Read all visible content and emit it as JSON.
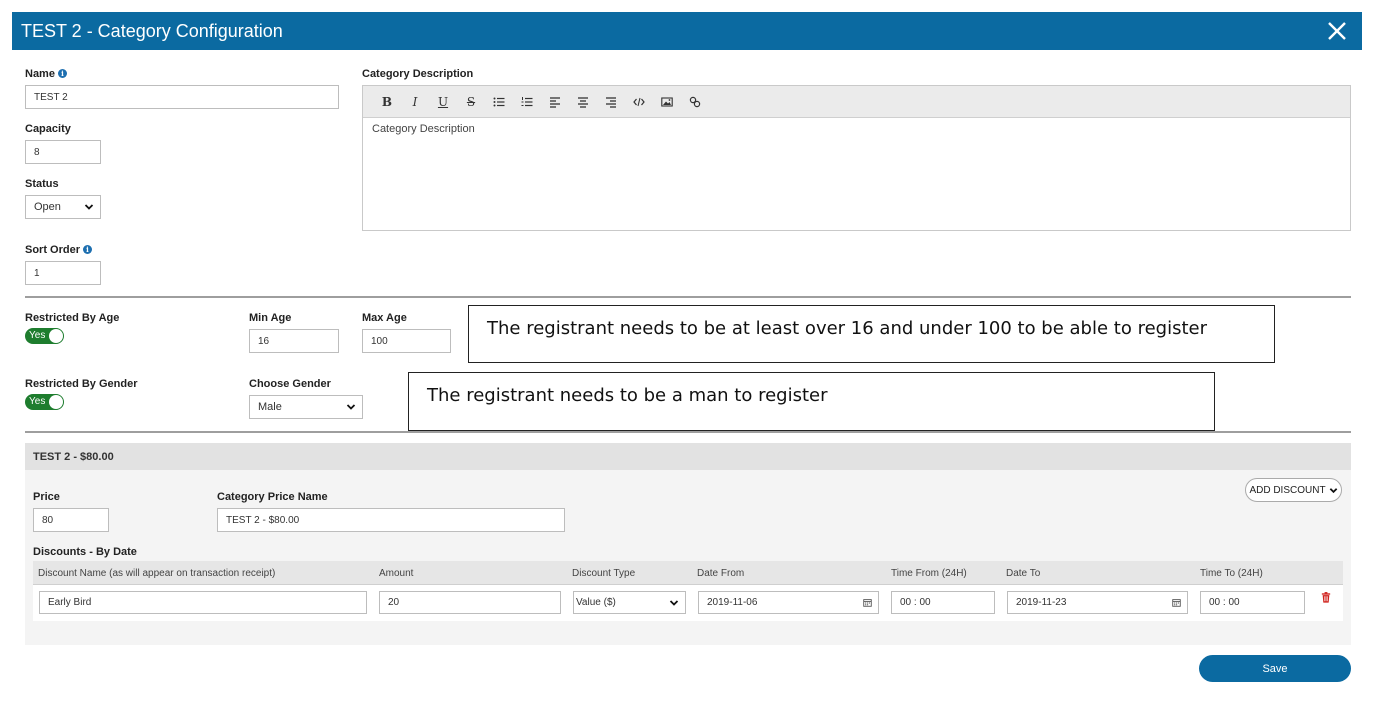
{
  "header": {
    "title": "TEST 2 - Category Configuration"
  },
  "form": {
    "name_label": "Name",
    "name_value": "TEST 2",
    "capacity_label": "Capacity",
    "capacity_value": "8",
    "status_label": "Status",
    "status_value": "Open",
    "sort_order_label": "Sort Order",
    "sort_order_value": "1",
    "description_label": "Category Description",
    "description_placeholder": "Category Description"
  },
  "toolbar": {
    "bold": "B",
    "italic": "I",
    "underline": "U",
    "strike": "S"
  },
  "age": {
    "restricted_label": "Restricted By Age",
    "restricted_value": "Yes",
    "min_label": "Min Age",
    "min_value": "16",
    "max_label": "Max Age",
    "max_value": "100",
    "note": "The registrant needs to be at least over 16 and under 100 to be able to register"
  },
  "gender": {
    "restricted_label": "Restricted By Gender",
    "restricted_value": "Yes",
    "choose_label": "Choose Gender",
    "choose_value": "Male",
    "note": "The registrant needs to be a man to register"
  },
  "pricing": {
    "header": "TEST 2 - $80.00",
    "add_discount": "ADD DISCOUNT",
    "price_label": "Price",
    "price_value": "80",
    "price_name_label": "Category Price Name",
    "price_name_value": "TEST 2 - $80.00",
    "discounts_label": "Discounts - By Date",
    "columns": [
      "Discount Name (as will appear on transaction receipt)",
      "Amount",
      "Discount Type",
      "Date From",
      "Time From (24H)",
      "Date To",
      "Time To (24H)"
    ],
    "row": {
      "name": "Early Bird",
      "amount": "20",
      "type": "Value ($)",
      "date_from": "2019-11-06",
      "time_from": "00 : 00",
      "date_to": "2019-11-23",
      "time_to": "00 : 00"
    }
  },
  "save_label": "Save",
  "colors": {
    "header_bg": "#0b6aa1",
    "toggle_on": "#1e7d2e",
    "delete": "#d0201b",
    "save_bg": "#0b6aa1"
  }
}
